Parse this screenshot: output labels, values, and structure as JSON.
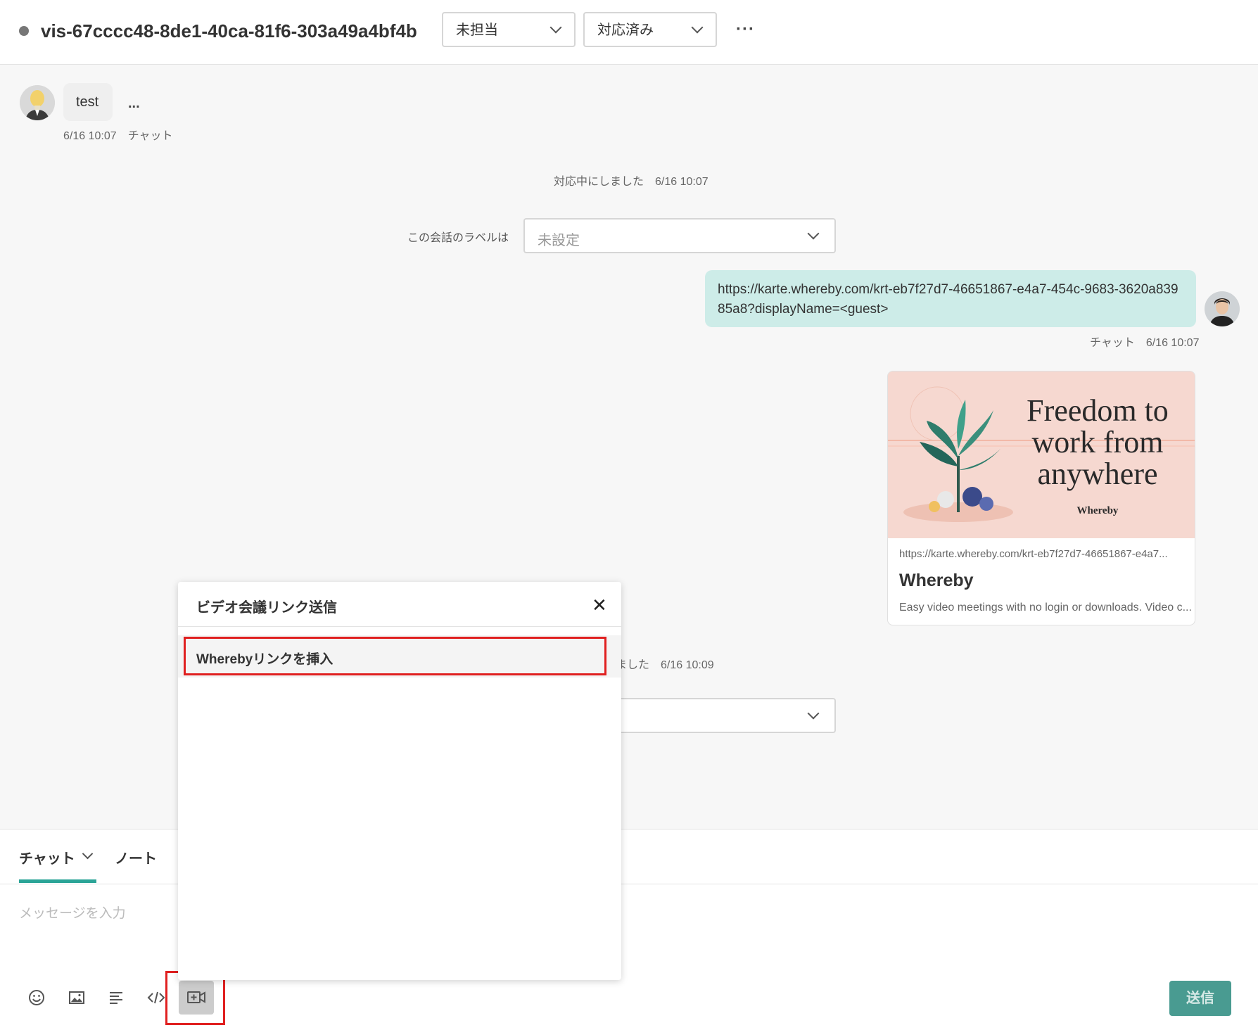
{
  "header": {
    "visitor_id": "vis-67cccc48-8de1-40ca-81f6-303a49a4bf4b",
    "assignee_select": "未担当",
    "status_select": "対応済み",
    "more": "···"
  },
  "messages": {
    "visitor": {
      "text": "test",
      "dots": "...",
      "meta": "6/16 10:07　チャット"
    },
    "system_1": "対応中にしました　6/16 10:07",
    "label_caption": "この会話のラベルは",
    "label_value": "未設定",
    "operator": {
      "text": "https://karte.whereby.com/krt-eb7f27d7-46651867-e4a7-454c-9683-3620a83985a8?displayName=<guest>",
      "meta": "チャット　6/16 10:07"
    },
    "preview": {
      "image_headline": [
        "Freedom to",
        "work from",
        "anywhere"
      ],
      "image_brand": "Whereby",
      "url": "https://karte.whereby.com/krt-eb7f27d7-46651867-e4a7...",
      "title": "Whereby",
      "description": "Easy video meetings with no login or downloads. Video c..."
    },
    "system_2": "ました　6/16 10:09"
  },
  "composer": {
    "tab_chat": "チャット",
    "tab_note": "ノート",
    "placeholder": "メッセージを入力",
    "send": "送信"
  },
  "popup": {
    "title": "ビデオ会議リンク送信",
    "close": "✕",
    "item": "Wherebyリンクを挿入"
  },
  "colors": {
    "accent": "#2ba497",
    "operator_bubble": "#cdece8",
    "highlight": "#e02020",
    "send_button": "#2a8a7e"
  }
}
